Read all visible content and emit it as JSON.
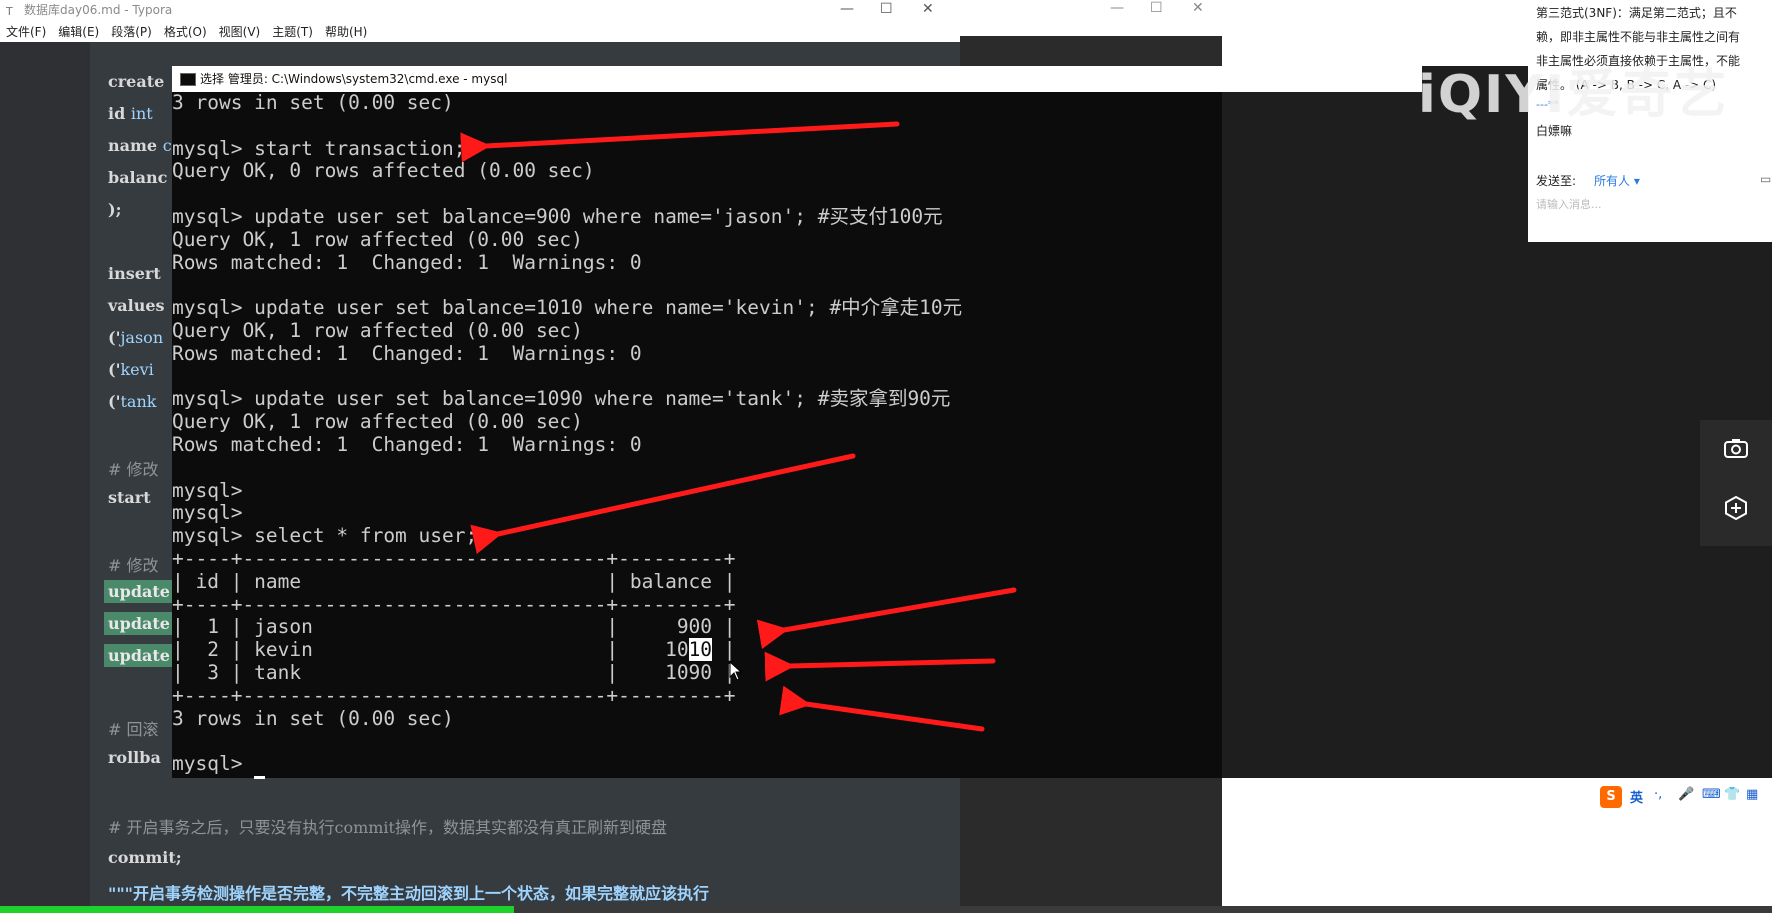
{
  "typora": {
    "title": "数据库day06.md - Typora",
    "menu": [
      "文件(F)",
      "编辑(E)",
      "段落(P)",
      "格式(O)",
      "视图(V)",
      "主题(T)",
      "帮助(H)"
    ],
    "code_lines": {
      "l1": "create",
      "l2a": "id ",
      "l2b": "int",
      "l3a": "name ",
      "l3b": "c",
      "l4": "balanc",
      "l5": ");",
      "l6": "insert",
      "l7": "values",
      "l8a": "('",
      "l8b": "jason",
      "l9a": "('",
      "l9b": "kevi",
      "l10a": "('",
      "l10b": "tank",
      "l11": "# 修改",
      "l12": "start",
      "l13": "# 修改",
      "l14": "update",
      "l15": "update",
      "l16": "update",
      "l17": "# 回滚",
      "l18": "rollba",
      "l19": "# 开启事务之后，只要没有执行commit操作，数据其实都没有真正刷新到硬盘",
      "l20": "commit;",
      "l21": "\"\"\"开启事务检测操作是否完整，不完整主动回滚到上一个状态，如果完整就应该执行"
    }
  },
  "cmd": {
    "title": "选择 管理员: C:\\Windows\\system32\\cmd.exe - mysql",
    "lines": [
      "3 rows in set (0.00 sec)",
      "",
      "mysql> start transaction;",
      "Query OK, 0 rows affected (0.00 sec)",
      "",
      "mysql> update user set balance=900 where name='jason'; #买支付100元",
      "Query OK, 1 row affected (0.00 sec)",
      "Rows matched: 1  Changed: 1  Warnings: 0",
      "",
      "mysql> update user set balance=1010 where name='kevin'; #中介拿走10元",
      "Query OK, 1 row affected (0.00 sec)",
      "Rows matched: 1  Changed: 1  Warnings: 0",
      "",
      "mysql> update user set balance=1090 where name='tank'; #卖家拿到90元",
      "Query OK, 1 row affected (0.00 sec)",
      "Rows matched: 1  Changed: 1  Warnings: 0",
      "",
      "mysql>",
      "mysql>",
      "mysql> select * from user;",
      "+----+-------------------------------+---------+",
      "| id | name                          | balance |",
      "+----+-------------------------------+---------+",
      "|  1 | jason                         |     900 |",
      "|  2 | kevin                         |    1010 |",
      "|  3 | tank                          |    1090 |",
      "+----+-------------------------------+---------+",
      "3 rows in set (0.00 sec)",
      "",
      "mysql> "
    ],
    "selection": {
      "line": 24,
      "prefix": "|  2 | kevin                         |    10",
      "selected": "10",
      "suffix": " |"
    }
  },
  "chat": {
    "line1": "第三范式(3NF)：满足第二范式；且不",
    "line2": "赖，即非主属性不能与非主属性之间有",
    "line3": "非主属性必须直接依赖于主属性，不能",
    "line4": "属性。 (A -> B, B -> C, A -> C)",
    "line5": "---**",
    "user": "白嫖嘛",
    "send_to_label": "发送至:",
    "send_to_value": "所有人 ▾",
    "input_placeholder": "请输入消息..."
  },
  "watermark": "iQIYI爱奇艺",
  "ime": {
    "items": [
      "英",
      "·,",
      "🎤",
      "⌨",
      "👕",
      "▦"
    ]
  },
  "side_buttons": {
    "camera": "camera-icon",
    "hex": "hexagon-plus-icon"
  },
  "progress": {
    "fraction": 0.29
  },
  "colors": {
    "arrow": "#ff1a1a",
    "progress": "#1fd12b",
    "terminal_bg": "#0c0c0c"
  }
}
